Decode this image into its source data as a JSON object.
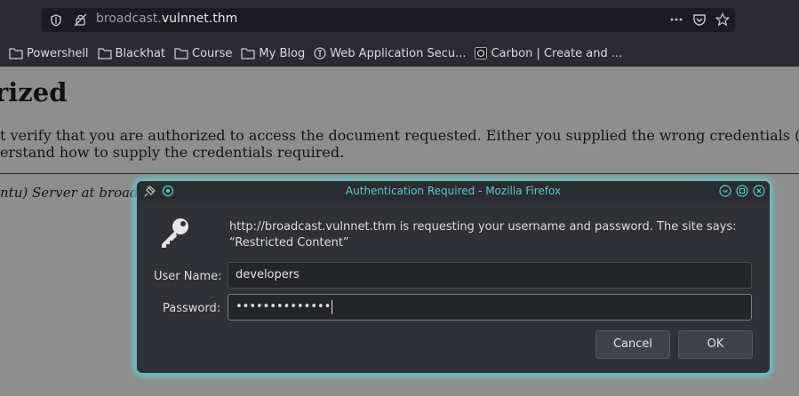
{
  "browser": {
    "url_scheme_part": "broadcast.",
    "url_host": "vulnnet.thm",
    "url_actions": [
      "more-icon",
      "pocket-icon",
      "star-icon"
    ],
    "bookmarks": [
      {
        "label": "Powershell",
        "icon": "folder-icon"
      },
      {
        "label": "Blackhat",
        "icon": "folder-icon"
      },
      {
        "label": "Course",
        "icon": "folder-icon"
      },
      {
        "label": "My Blog",
        "icon": "folder-icon"
      },
      {
        "label": "Web Application Secu...",
        "icon": "site-icon"
      },
      {
        "label": "Carbon | Create and ...",
        "icon": "carbon-icon"
      }
    ]
  },
  "page": {
    "heading": "rized",
    "para_line1": "t verify that you are authorized to access the document requested. Either you supplied the wrong credentials (e",
    "para_line2": "erstand how to supply the credentials required.",
    "address": "ntu) Server at broad"
  },
  "dialog": {
    "title": "Authentication Required - Mozilla Firefox",
    "message": "http://broadcast.vulnnet.thm is requesting your username and password. The site says: “Restricted Content”",
    "username_label": "User Name:",
    "username_value": "developers",
    "password_label": "Password:",
    "password_value": "••••••••••••••",
    "cancel_label": "Cancel",
    "ok_label": "OK"
  },
  "colors": {
    "accent": "#5ec9c9",
    "dialog_bg": "#2f3136",
    "chrome_bg": "#2b2a33"
  }
}
